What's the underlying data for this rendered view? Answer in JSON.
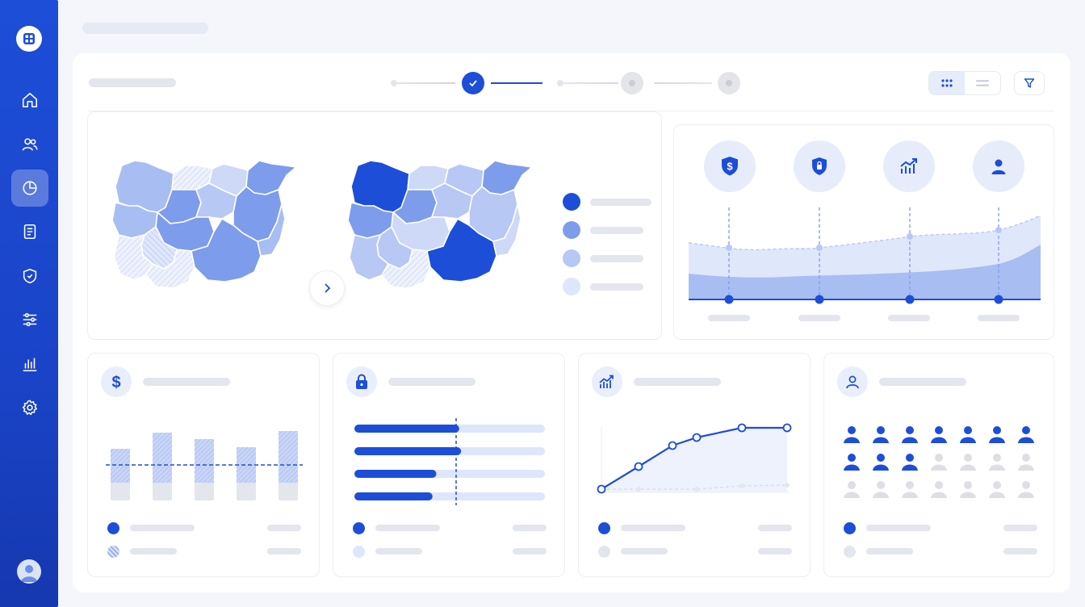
{
  "colors": {
    "primary": "#1d4ed8",
    "mid": "#7e9cec",
    "light": "#b7c8f5",
    "pale": "#dde6fb",
    "skeleton": "#e3e6ec",
    "inactive": "#dedfe4"
  },
  "sidebar": {
    "logo_icon": "app-logo-icon",
    "items": [
      {
        "icon": "home-icon",
        "active": false
      },
      {
        "icon": "users-icon",
        "active": false
      },
      {
        "icon": "pie-chart-icon",
        "active": true
      },
      {
        "icon": "document-icon",
        "active": false
      },
      {
        "icon": "shield-icon",
        "active": false
      },
      {
        "icon": "sliders-icon",
        "active": false
      },
      {
        "icon": "bar-chart-icon",
        "active": false
      },
      {
        "icon": "gear-icon",
        "active": false
      }
    ],
    "user_icon": "avatar-icon"
  },
  "stepper": {
    "steps": [
      {
        "state": "done"
      },
      {
        "state": "pending"
      },
      {
        "state": "pending"
      }
    ]
  },
  "view_toggle": {
    "selected": "grid"
  },
  "map_panel": {
    "legend_levels": 4
  },
  "kpi_panel": {
    "icons": [
      "shield-dollar-icon",
      "shield-lock-icon",
      "trend-up-icon",
      "person-icon"
    ]
  },
  "cards": [
    {
      "icon": "dollar-icon",
      "kind": "bar"
    },
    {
      "icon": "lock-icon",
      "kind": "progress",
      "progress": [
        0.55,
        0.56,
        0.43,
        0.41
      ]
    },
    {
      "icon": "trend-up-icon",
      "kind": "line"
    },
    {
      "icon": "person-icon",
      "kind": "people",
      "people_filled": 10,
      "people_total": 21
    }
  ]
}
